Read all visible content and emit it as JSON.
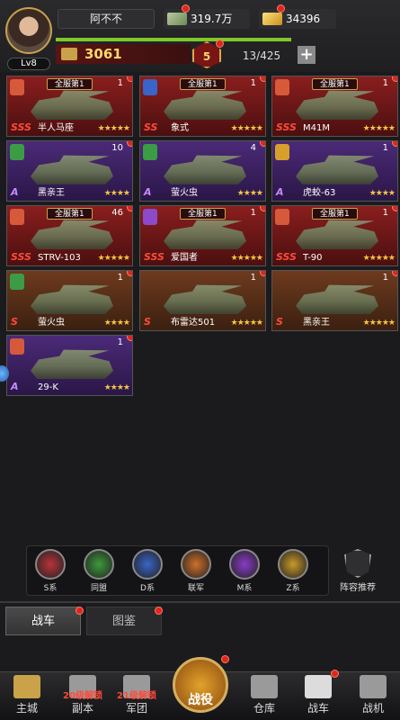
{
  "player": {
    "name": "阿不不",
    "level": "Lv8",
    "money": "319.7万",
    "gold": "34396",
    "power": "3061",
    "rank": "5",
    "xp_fraction": 1.0,
    "capacity": "13/425"
  },
  "vehicles": [
    {
      "name": "半人马座",
      "rarity": "SSS",
      "count": "1",
      "badge": "全服第1",
      "stars": "★★★★★",
      "theme": "red",
      "emblem": "red"
    },
    {
      "name": "象式",
      "rarity": "SS",
      "count": "1",
      "badge": "全服第1",
      "stars": "★★★★★",
      "theme": "red",
      "emblem": "blue"
    },
    {
      "name": "M41M",
      "rarity": "SSS",
      "count": "1",
      "badge": "全服第1",
      "stars": "★★★★★",
      "theme": "red",
      "emblem": "red"
    },
    {
      "name": "黑亲王",
      "rarity": "A",
      "count": "10",
      "badge": "",
      "stars": "★★★★",
      "theme": "purple",
      "emblem": "green"
    },
    {
      "name": "萤火虫",
      "rarity": "A",
      "count": "4",
      "badge": "",
      "stars": "★★★★",
      "theme": "purple",
      "emblem": "green"
    },
    {
      "name": "虎蛟-63",
      "rarity": "A",
      "count": "1",
      "badge": "",
      "stars": "★★★★",
      "theme": "purple",
      "emblem": "yellow"
    },
    {
      "name": "STRV-103",
      "rarity": "SSS",
      "count": "46",
      "badge": "全服第1",
      "stars": "★★★★★",
      "theme": "red",
      "emblem": "red"
    },
    {
      "name": "爱国者",
      "rarity": "SSS",
      "count": "1",
      "badge": "全服第1",
      "stars": "★★★★★",
      "theme": "red",
      "emblem": "purple"
    },
    {
      "name": "T-90",
      "rarity": "SSS",
      "count": "1",
      "badge": "全服第1",
      "stars": "★★★★★",
      "theme": "red",
      "emblem": "red"
    },
    {
      "name": "萤火虫",
      "rarity": "S",
      "count": "1",
      "badge": "",
      "stars": "★★★★",
      "theme": "orange",
      "emblem": "green"
    },
    {
      "name": "布雷达501",
      "rarity": "S",
      "count": "1",
      "badge": "",
      "stars": "★★★★★",
      "theme": "orange",
      "emblem": "none"
    },
    {
      "name": "黑亲王",
      "rarity": "S",
      "count": "1",
      "badge": "",
      "stars": "★★★★★",
      "theme": "orange",
      "emblem": "none"
    },
    {
      "name": "29-K",
      "rarity": "A",
      "count": "1",
      "badge": "",
      "stars": "★★★★",
      "theme": "purple",
      "emblem": "red"
    }
  ],
  "filters": [
    "S系",
    "同盟",
    "D系",
    "联军",
    "M系",
    "Z系"
  ],
  "recommend_label": "阵容推荐",
  "tabs": {
    "active": "战车",
    "inactive": "图鉴"
  },
  "nav": {
    "main_city": "主城",
    "copy": "副本",
    "copy_lock": "20级解锁",
    "legion": "军团",
    "legion_lock": "21级解锁",
    "battle": "战役",
    "warehouse": "仓库",
    "tanks": "战车",
    "aircraft": "战机"
  }
}
